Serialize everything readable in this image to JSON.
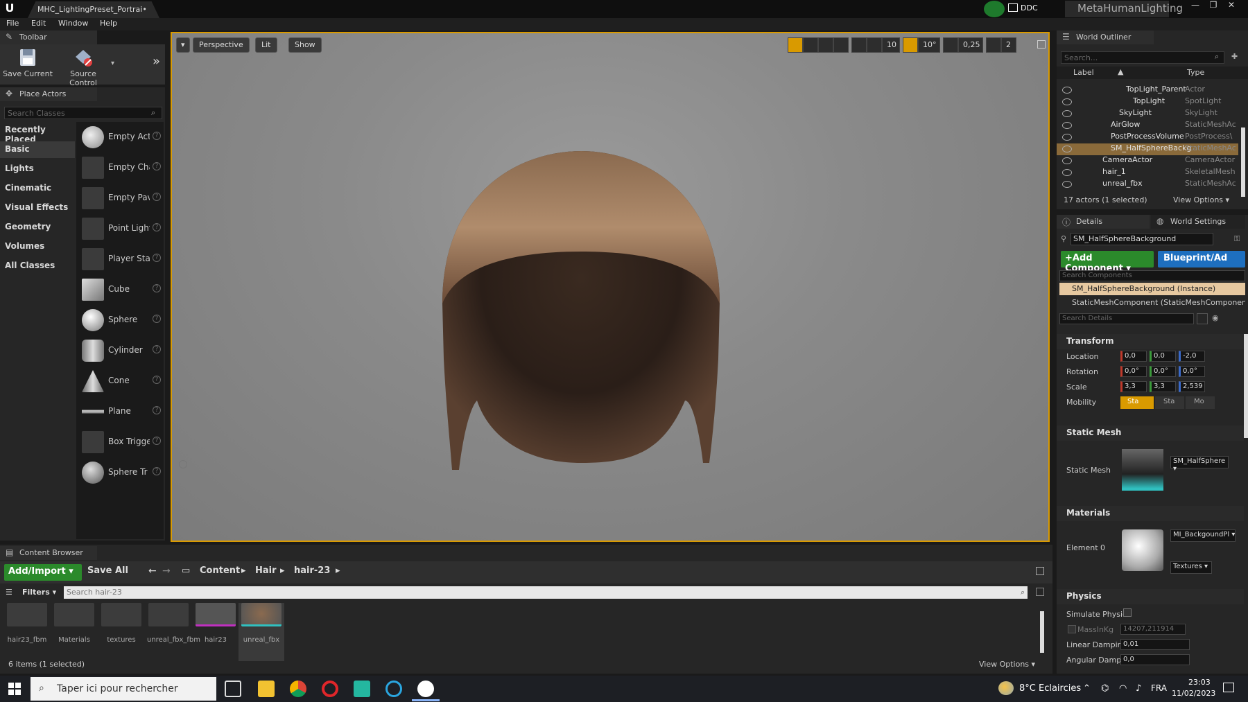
{
  "titlebar": {
    "doc_tab": "MHC_LightingPreset_Portrai•",
    "ddc": "DDC",
    "project": "MetaHumanLighting",
    "minimize": "—",
    "maximize": "❐",
    "close": "✕"
  },
  "menu": [
    "File",
    "Edit",
    "Window",
    "Help"
  ],
  "toolbar": {
    "tab": "Toolbar",
    "save_label": "Save Current",
    "source_control_label": "Source Control"
  },
  "place_actors": {
    "tab": "Place Actors",
    "search_placeholder": "Search Classes",
    "categories": [
      "Recently Placed",
      "Basic",
      "Lights",
      "Cinematic",
      "Visual Effects",
      "Geometry",
      "Volumes",
      "All Classes"
    ],
    "items": [
      "Empty Act",
      "Empty Cha",
      "Empty Pav",
      "Point Light",
      "Player Sta",
      "Cube",
      "Sphere",
      "Cylinder",
      "Cone",
      "Plane",
      "Box Trigge",
      "Sphere Tr"
    ]
  },
  "viewport": {
    "perspective": "Perspective",
    "lit": "Lit",
    "show": "Show",
    "grid": "10",
    "angle": "10°",
    "scale": "0,25",
    "cam_speed": "2"
  },
  "content_browser": {
    "tab": "Content Browser",
    "add_import": "Add/Import",
    "save_all": "Save All",
    "breadcrumbs": [
      "Content",
      "Hair",
      "hair-23"
    ],
    "filters": "Filters",
    "search_placeholder": "Search hair-23",
    "assets": [
      "hair23_fbm",
      "Materials",
      "textures",
      "unreal_fbx_fbm",
      "hair23",
      "unreal_fbx"
    ],
    "status": "6 items (1 selected)",
    "view_options": "View Options"
  },
  "outliner": {
    "tab": "World Outliner",
    "search_placeholder": "Search...",
    "col_label": "Label",
    "col_type": "Type",
    "rows": [
      {
        "label": "TopLight_Parent",
        "type": "Actor"
      },
      {
        "label": "TopLight",
        "type": "SpotLight"
      },
      {
        "label": "SkyLight",
        "type": "SkyLight"
      },
      {
        "label": "AirGlow",
        "type": "StaticMeshAc"
      },
      {
        "label": "PostProcessVolume",
        "type": "PostProcess\\"
      },
      {
        "label": "SM_HalfSphereBackg",
        "type": "StaticMeshAc"
      },
      {
        "label": "CameraActor",
        "type": "CameraActor"
      },
      {
        "label": "hair_1",
        "type": "SkeletalMesh"
      },
      {
        "label": "unreal_fbx",
        "type": "StaticMeshAc"
      }
    ],
    "status": "17 actors (1 selected)",
    "view_options": "View Options"
  },
  "details": {
    "tab": "Details",
    "world_settings_tab": "World Settings",
    "name_value": "SM_HalfSphereBackground",
    "add_component": "Add Component",
    "blueprint": "Blueprint/Ad",
    "search_components": "Search Components",
    "instance": "SM_HalfSphereBackground (Instance)",
    "component": "StaticMeshComponent (StaticMeshComponent",
    "search_details": "Search Details",
    "transform": "Transform",
    "location_label": "Location",
    "location": [
      "0,0",
      "0,0",
      "-2,0"
    ],
    "rotation_label": "Rotation",
    "rotation": [
      "0,0°",
      "0,0°",
      "0,0°"
    ],
    "scale_label": "Scale",
    "scale": [
      "3,3",
      "3,3",
      "2,539"
    ],
    "mobility_label": "Mobility",
    "mobility": [
      "Sta",
      "Sta",
      "Mo"
    ],
    "static_mesh_section": "Static Mesh",
    "static_mesh_label": "Static Mesh",
    "static_mesh_value": "SM_HalfSphere",
    "materials_section": "Materials",
    "element0_label": "Element 0",
    "element0_value": "MI_BackgoundPl",
    "textures": "Textures",
    "physics_section": "Physics",
    "simulate_label": "Simulate Physic",
    "mass_label": "MassInKg",
    "mass_value": "14207,211914",
    "linear_damping_label": "Linear Damping",
    "linear_damping": "0,01",
    "angular_damping_label": "Angular Dampin",
    "angular_damping": "0,0"
  },
  "taskbar": {
    "search_placeholder": "Taper ici pour rechercher",
    "weather": "8°C  Eclaircies",
    "lang": "FRA",
    "time": "23:03",
    "date": "11/02/2023"
  }
}
